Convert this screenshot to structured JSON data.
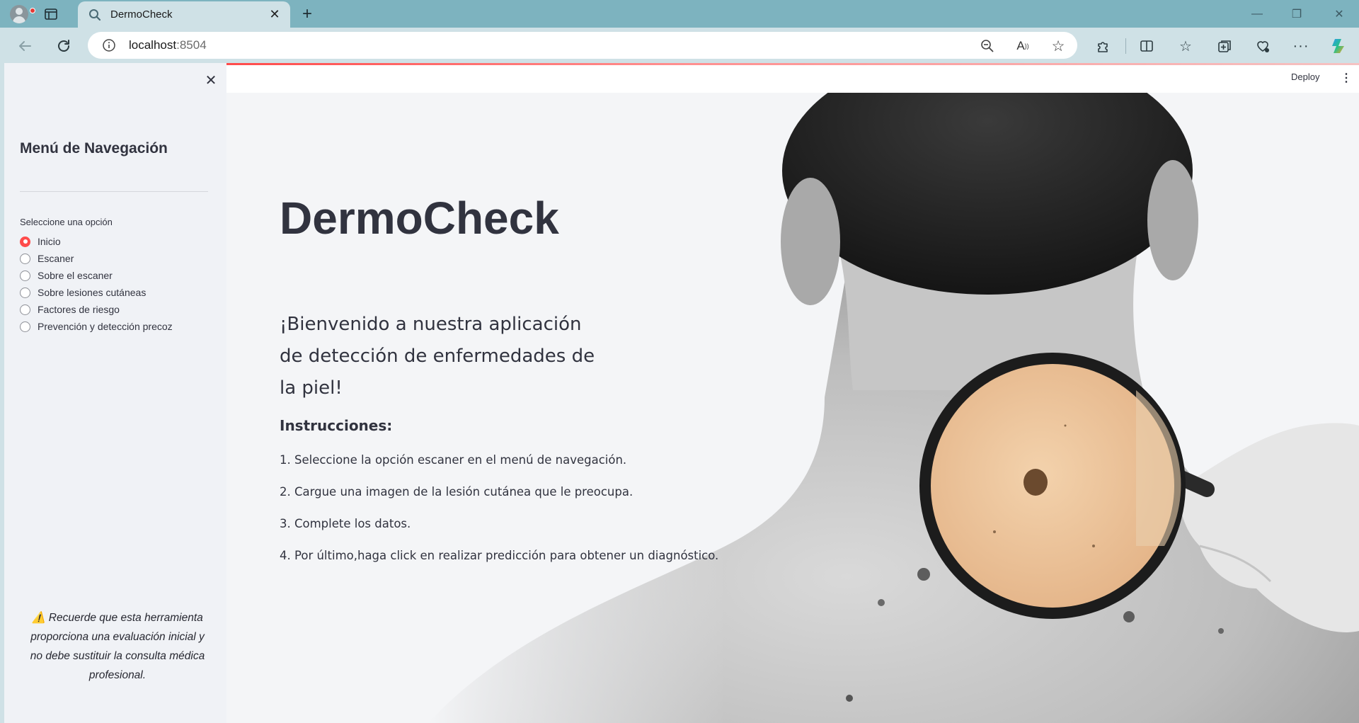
{
  "browser": {
    "tab_title": "DermoCheck",
    "url_host": "localhost",
    "url_port": ":8504"
  },
  "header": {
    "deploy_label": "Deploy"
  },
  "sidebar": {
    "title": "Menú de Navegación",
    "radio_label": "Seleccione una opción",
    "options": [
      "Inicio",
      "Escaner",
      "Sobre el escaner",
      "Sobre lesiones cutáneas",
      "Factores de riesgo",
      "Prevención y detección precoz"
    ],
    "selected": "Inicio",
    "warning": "⚠️ Recuerde que esta herramienta proporciona una evaluación inicial y no debe sustituir la consulta médica profesional."
  },
  "main": {
    "title": "DermoCheck",
    "welcome": "¡Bienvenido a nuestra aplicación de detección de enfermedades de la piel!",
    "instructions_title": "Instrucciones:",
    "steps": [
      "1. Seleccione la opción escaner en el menú de navegación.",
      "2. Cargue una imagen de la lesión cutánea que le preocupa.",
      "3. Complete los datos.",
      "4. Por último,haga click en realizar predicción para obtener un diagnóstico."
    ]
  },
  "colors": {
    "accent": "#ff4b4b",
    "text": "#31333f",
    "sidebar_bg": "#f0f2f6",
    "tabbar_bg": "#7db3bf"
  },
  "icons": {
    "profile": "profile-avatar-icon",
    "tabs": "tab-actions-icon",
    "search": "search-icon",
    "close": "close-icon",
    "new_tab": "plus-icon",
    "back": "back-arrow-icon",
    "refresh": "refresh-icon",
    "info": "info-icon",
    "zoom": "zoom-out-icon",
    "read_aloud": "read-aloud-icon",
    "favorite": "star-icon",
    "extensions": "puzzle-icon",
    "split": "split-screen-icon",
    "favorites": "favorites-icon",
    "collections": "collections-icon",
    "health": "browser-essentials-icon",
    "more": "more-icon",
    "copilot": "copilot-icon"
  }
}
